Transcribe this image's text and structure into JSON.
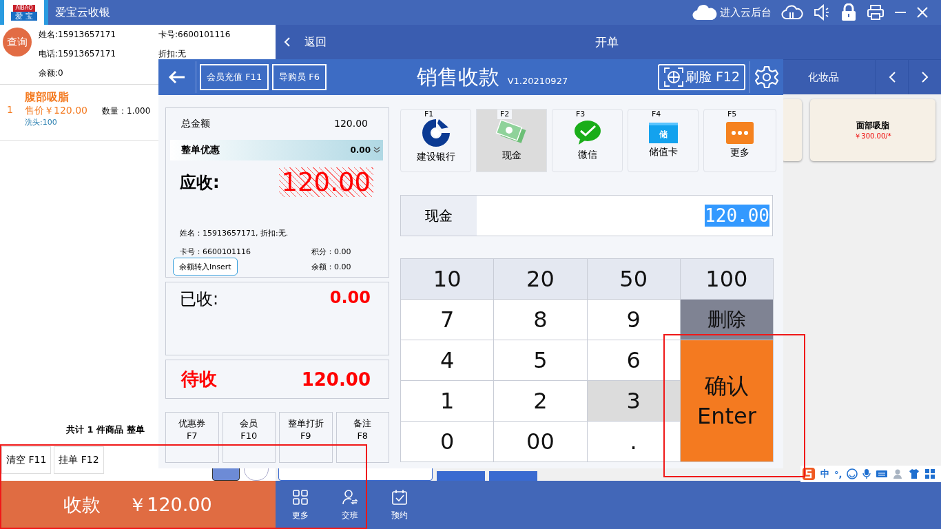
{
  "logo": {
    "top": "AIBAO",
    "bottom": "爱 宝"
  },
  "app_title": "爱宝云收银",
  "cloud_label": "进入云后台",
  "member": {
    "query": "查询",
    "name": "姓名:15913657171",
    "card": "卡号:6600101116",
    "phone": "电话:15913657171",
    "discount": "折扣:无",
    "balance": "余额:0"
  },
  "cart": [
    {
      "index": "1",
      "name": "腹部吸脂",
      "price": "售价￥120.00",
      "qty": "数量：1.000",
      "note": "洗头:100"
    }
  ],
  "cart_summary": "共计 1 件商品 整单",
  "order_bar": {
    "back": "返回",
    "title": "开单"
  },
  "category": "化妆品",
  "products": [
    {
      "name": "面部吸脂",
      "price": "￥300.00/*"
    }
  ],
  "cart_actions": [
    "清空 F11",
    "挂单 F12"
  ],
  "checkout": {
    "label": "收款",
    "amount": "￥120.00"
  },
  "nav": [
    "更多",
    "交班",
    "预约"
  ],
  "ime": {
    "mode": "中",
    "punct": "°,"
  },
  "dialog": {
    "title": "销售收款",
    "version": "V1.20210927",
    "header_buttons": [
      "会员充值 F11",
      "导购员 F6"
    ],
    "face_button": "刷脸 F12",
    "summary": {
      "total_label": "总金额",
      "total": "120.00",
      "discount_label": "整单优惠",
      "discount": "0.00",
      "due_label": "应收:",
      "due": "120.00",
      "member_line": "姓名：15913657171, 折扣:无.",
      "card_line": "卡号：6600101116",
      "points": "积分：0.00",
      "balance": "余额：0.00",
      "transfer_button": "余额转入Insert"
    },
    "received_label": "已收:",
    "received": "0.00",
    "pending_label": "待收",
    "pending": "120.00",
    "actions": [
      {
        "label": "优惠券",
        "key": "F7"
      },
      {
        "label": "会员",
        "key": "F10"
      },
      {
        "label": "整单打折",
        "key": "F9"
      },
      {
        "label": "备注",
        "key": "F8"
      }
    ],
    "methods": [
      {
        "key": "F1",
        "label": "建设银行",
        "selected": false
      },
      {
        "key": "F2",
        "label": "现金",
        "selected": true
      },
      {
        "key": "F3",
        "label": "微信",
        "selected": false
      },
      {
        "key": "F4",
        "label": "储值卡",
        "selected": false,
        "icon_text": "储"
      },
      {
        "key": "F5",
        "label": "更多",
        "selected": false
      }
    ],
    "tender": {
      "label": "现金",
      "value": "120.00"
    },
    "keypad": [
      {
        "label": "10",
        "kind": "quick",
        "pressed": false
      },
      {
        "label": "20",
        "kind": "quick",
        "pressed": false
      },
      {
        "label": "50",
        "kind": "quick",
        "pressed": false
      },
      {
        "label": "100",
        "kind": "quick",
        "pressed": false
      },
      {
        "label": "7",
        "kind": "digit",
        "pressed": false
      },
      {
        "label": "8",
        "kind": "digit",
        "pressed": false
      },
      {
        "label": "9",
        "kind": "digit",
        "pressed": false
      },
      {
        "label": "删除",
        "kind": "delete",
        "pressed": false
      },
      {
        "label": "4",
        "kind": "digit",
        "pressed": false
      },
      {
        "label": "5",
        "kind": "digit",
        "pressed": false
      },
      {
        "label": "6",
        "kind": "digit",
        "pressed": false
      },
      {
        "label": "1",
        "kind": "digit",
        "pressed": false
      },
      {
        "label": "2",
        "kind": "digit",
        "pressed": false
      },
      {
        "label": "3",
        "kind": "digit",
        "pressed": true
      },
      {
        "label": "0",
        "kind": "digit",
        "pressed": false
      },
      {
        "label": "00",
        "kind": "digit",
        "pressed": false
      },
      {
        "label": ".",
        "kind": "digit",
        "pressed": false
      },
      {
        "label": "确认\nEnter",
        "kind": "confirm",
        "pressed": false
      }
    ]
  }
}
